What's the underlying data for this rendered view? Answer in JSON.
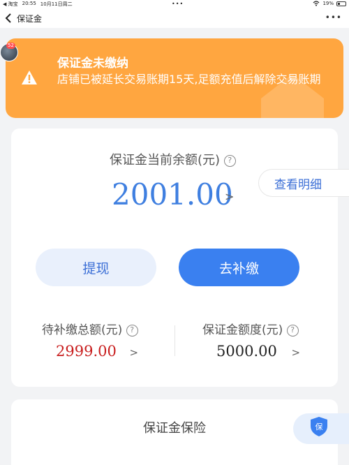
{
  "status_bar": {
    "back_app": "◀ 淘宝",
    "time": "20:55",
    "date": "10月11日周二",
    "center_dots": "•••",
    "battery": "19%"
  },
  "nav": {
    "title": "保证金",
    "more": "•••"
  },
  "avatar": {
    "badge": "52"
  },
  "notice": {
    "title": "保证金未缴纳",
    "text": "店铺已被延长交易账期15天,足额充值后解除交易账期"
  },
  "balance": {
    "label": "保证金当前余额(元)",
    "amount": "2001.00",
    "detail_button": "查看明细"
  },
  "actions": {
    "withdraw": "提现",
    "pay": "去补缴"
  },
  "stats": {
    "due_label": "待补缴总额(元)",
    "due_value": "2999.00",
    "due_color": "#c81d1d",
    "quota_label": "保证金额度(元)",
    "quota_value": "5000.00",
    "quota_color": "#222222"
  },
  "insurance": {
    "title": "保证金保险",
    "shield_text": "保"
  }
}
